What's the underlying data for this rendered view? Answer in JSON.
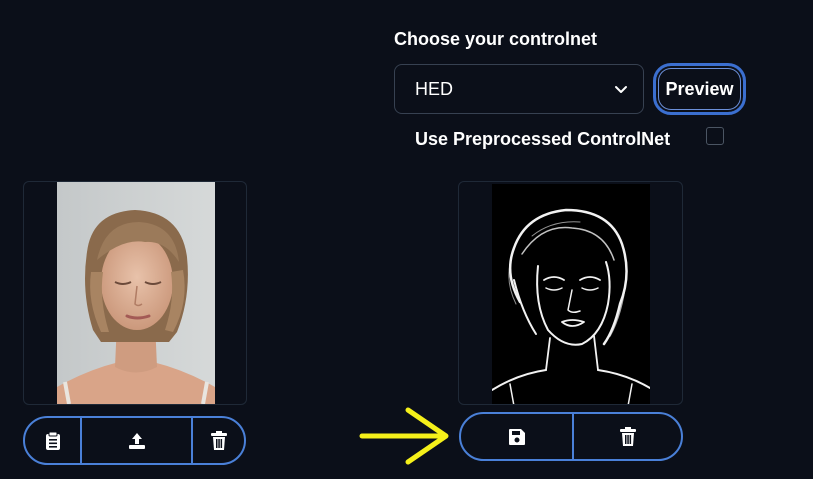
{
  "controlnet": {
    "label": "Choose your controlnet",
    "selected": "HED",
    "preview_button": "Preview"
  },
  "preprocess": {
    "label": "Use Preprocessed ControlNet",
    "checked": false
  },
  "colors": {
    "background": "#0b0f19",
    "accent_border": "#4a80d8",
    "annotation_arrow": "#f5f01a"
  },
  "icons": {
    "left_toolbar": [
      "clipboard-icon",
      "upload-icon",
      "trash-icon"
    ],
    "right_toolbar": [
      "save-icon",
      "trash-icon"
    ],
    "annotation": "arrow-right-icon"
  }
}
